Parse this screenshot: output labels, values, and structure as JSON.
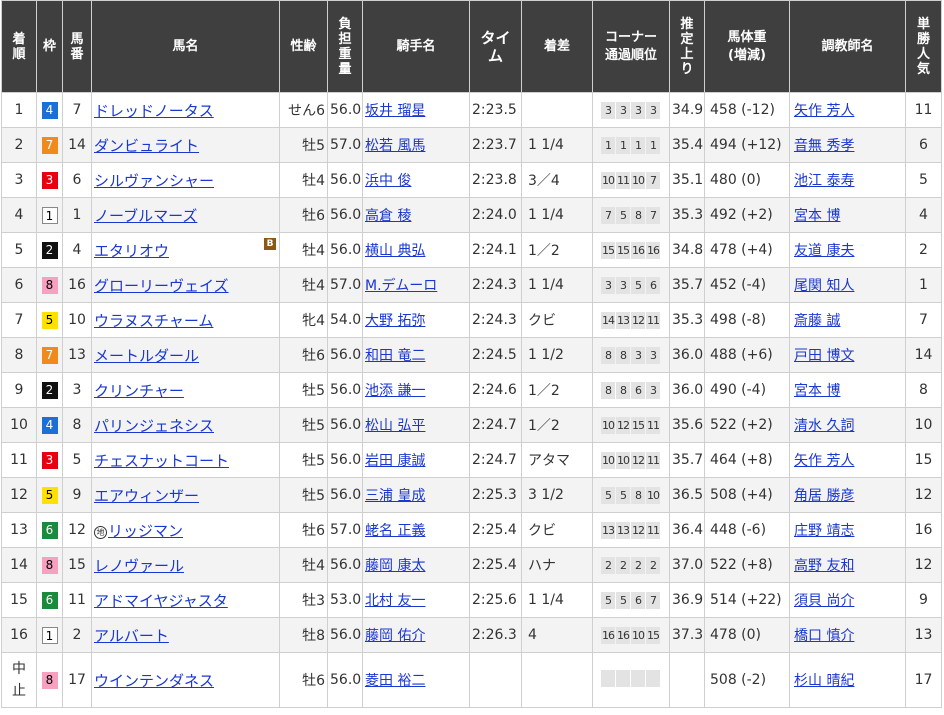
{
  "headers": {
    "rank": "着\n順",
    "waku": "枠",
    "num": "馬\n番",
    "horse": "馬名",
    "sexage": "性齢",
    "weight": "負\n担\n重\n量",
    "jockey": "騎手名",
    "time": "タイ\nム",
    "margin": "着差",
    "corner": "コーナー\n通過順位",
    "last3f": "推\n定\n上\nり",
    "body": "馬体重\n(増減)",
    "trainer": "調教師名",
    "pop": "単\n勝\n人\n気"
  },
  "rows": [
    {
      "rank": "1",
      "waku": "4",
      "num": "7",
      "horse": "ドレッドノータス",
      "sexage": "せん6",
      "weight": "56.0",
      "jockey": "坂井 瑠星",
      "time": "2:23.5",
      "margin": "",
      "corner": [
        "3",
        "3",
        "3",
        "3"
      ],
      "last3f": "34.9",
      "body": "458 (-12)",
      "trainer": "矢作 芳人",
      "pop": "11"
    },
    {
      "rank": "2",
      "waku": "7",
      "num": "14",
      "horse": "ダンビュライト",
      "sexage": "牡5",
      "weight": "57.0",
      "jockey": "松若 風馬",
      "time": "2:23.7",
      "margin": "1 1/4",
      "corner": [
        "1",
        "1",
        "1",
        "1"
      ],
      "last3f": "35.4",
      "body": "494 (+12)",
      "trainer": "音無 秀孝",
      "pop": "6"
    },
    {
      "rank": "3",
      "waku": "3",
      "num": "6",
      "horse": "シルヴァンシャー",
      "sexage": "牡4",
      "weight": "56.0",
      "jockey": "浜中 俊",
      "time": "2:23.8",
      "margin": "3／4",
      "corner": [
        "10",
        "11",
        "10",
        "7"
      ],
      "last3f": "35.1",
      "body": "480 (0)",
      "trainer": "池江 泰寿",
      "pop": "5"
    },
    {
      "rank": "4",
      "waku": "1",
      "num": "1",
      "horse": "ノーブルマーズ",
      "sexage": "牡6",
      "weight": "56.0",
      "jockey": "高倉 稜",
      "time": "2:24.0",
      "margin": "1 1/4",
      "corner": [
        "7",
        "5",
        "8",
        "7"
      ],
      "last3f": "35.3",
      "body": "492 (+2)",
      "trainer": "宮本 博",
      "pop": "4"
    },
    {
      "rank": "5",
      "waku": "2",
      "num": "4",
      "horse": "エタリオウ",
      "sexage": "牡4",
      "weight": "56.0",
      "jockey": "横山 典弘",
      "time": "2:24.1",
      "margin": "1／2",
      "corner": [
        "15",
        "15",
        "16",
        "16"
      ],
      "last3f": "34.8",
      "body": "478 (+4)",
      "trainer": "友道 康夫",
      "pop": "2",
      "blinker": "B"
    },
    {
      "rank": "6",
      "waku": "8",
      "num": "16",
      "horse": "グローリーヴェイズ",
      "sexage": "牡4",
      "weight": "57.0",
      "jockey": "M.デムーロ",
      "time": "2:24.3",
      "margin": "1 1/4",
      "corner": [
        "3",
        "3",
        "5",
        "6"
      ],
      "last3f": "35.7",
      "body": "452 (-4)",
      "trainer": "尾関 知人",
      "pop": "1"
    },
    {
      "rank": "7",
      "waku": "5",
      "num": "10",
      "horse": "ウラヌスチャーム",
      "sexage": "牝4",
      "weight": "54.0",
      "jockey": "大野 拓弥",
      "time": "2:24.3",
      "margin": "クビ",
      "corner": [
        "14",
        "13",
        "12",
        "11"
      ],
      "last3f": "35.3",
      "body": "498 (-8)",
      "trainer": "斎藤 誠",
      "pop": "7"
    },
    {
      "rank": "8",
      "waku": "7",
      "num": "13",
      "horse": "メートルダール",
      "sexage": "牡6",
      "weight": "56.0",
      "jockey": "和田 竜二",
      "time": "2:24.5",
      "margin": "1 1/2",
      "corner": [
        "8",
        "8",
        "3",
        "3"
      ],
      "last3f": "36.0",
      "body": "488 (+6)",
      "trainer": "戸田 博文",
      "pop": "14"
    },
    {
      "rank": "9",
      "waku": "2",
      "num": "3",
      "horse": "クリンチャー",
      "sexage": "牡5",
      "weight": "56.0",
      "jockey": "池添 謙一",
      "time": "2:24.6",
      "margin": "1／2",
      "corner": [
        "8",
        "8",
        "6",
        "3"
      ],
      "last3f": "36.0",
      "body": "490 (-4)",
      "trainer": "宮本 博",
      "pop": "8"
    },
    {
      "rank": "10",
      "waku": "4",
      "num": "8",
      "horse": "パリンジェネシス",
      "sexage": "牡5",
      "weight": "56.0",
      "jockey": "松山 弘平",
      "time": "2:24.7",
      "margin": "1／2",
      "corner": [
        "10",
        "12",
        "15",
        "11"
      ],
      "last3f": "35.6",
      "body": "522 (+2)",
      "trainer": "清水 久詞",
      "pop": "10"
    },
    {
      "rank": "11",
      "waku": "3",
      "num": "5",
      "horse": "チェスナットコート",
      "sexage": "牡5",
      "weight": "56.0",
      "jockey": "岩田 康誠",
      "time": "2:24.7",
      "margin": "アタマ",
      "corner": [
        "10",
        "10",
        "12",
        "11"
      ],
      "last3f": "35.7",
      "body": "464 (+8)",
      "trainer": "矢作 芳人",
      "pop": "15"
    },
    {
      "rank": "12",
      "waku": "5",
      "num": "9",
      "horse": "エアウィンザー",
      "sexage": "牡5",
      "weight": "56.0",
      "jockey": "三浦 皇成",
      "time": "2:25.3",
      "margin": "3 1/2",
      "corner": [
        "5",
        "5",
        "8",
        "10"
      ],
      "last3f": "36.5",
      "body": "508 (+4)",
      "trainer": "角居 勝彦",
      "pop": "12"
    },
    {
      "rank": "13",
      "waku": "6",
      "num": "12",
      "horse": "リッジマン",
      "sexage": "牡6",
      "weight": "57.0",
      "jockey": "蛯名 正義",
      "time": "2:25.4",
      "margin": "クビ",
      "corner": [
        "13",
        "13",
        "12",
        "11"
      ],
      "last3f": "36.4",
      "body": "448 (-6)",
      "trainer": "庄野 靖志",
      "pop": "16",
      "mark": "地"
    },
    {
      "rank": "14",
      "waku": "8",
      "num": "15",
      "horse": "レノヴァール",
      "sexage": "牡4",
      "weight": "56.0",
      "jockey": "藤岡 康太",
      "time": "2:25.4",
      "margin": "ハナ",
      "corner": [
        "2",
        "2",
        "2",
        "2"
      ],
      "last3f": "37.0",
      "body": "522 (+8)",
      "trainer": "高野 友和",
      "pop": "12"
    },
    {
      "rank": "15",
      "waku": "6",
      "num": "11",
      "horse": "アドマイヤジャスタ",
      "sexage": "牡3",
      "weight": "53.0",
      "jockey": "北村 友一",
      "time": "2:25.6",
      "margin": "1 1/4",
      "corner": [
        "5",
        "5",
        "6",
        "7"
      ],
      "last3f": "36.9",
      "body": "514 (+22)",
      "trainer": "須貝 尚介",
      "pop": "9"
    },
    {
      "rank": "16",
      "waku": "1",
      "num": "2",
      "horse": "アルバート",
      "sexage": "牡8",
      "weight": "56.0",
      "jockey": "藤岡 佑介",
      "time": "2:26.3",
      "margin": "4",
      "corner": [
        "16",
        "16",
        "10",
        "15"
      ],
      "last3f": "37.3",
      "body": "478 (0)",
      "trainer": "橋口 慎介",
      "pop": "13"
    },
    {
      "rank": "中\n止",
      "waku": "8",
      "num": "17",
      "horse": "ウインテンダネス",
      "sexage": "牡6",
      "weight": "56.0",
      "jockey": "菱田 裕二",
      "time": "",
      "margin": "",
      "corner": [
        "",
        "",
        "",
        ""
      ],
      "last3f": "",
      "body": "508 (-2)",
      "trainer": "杉山 晴紀",
      "pop": "17"
    }
  ]
}
